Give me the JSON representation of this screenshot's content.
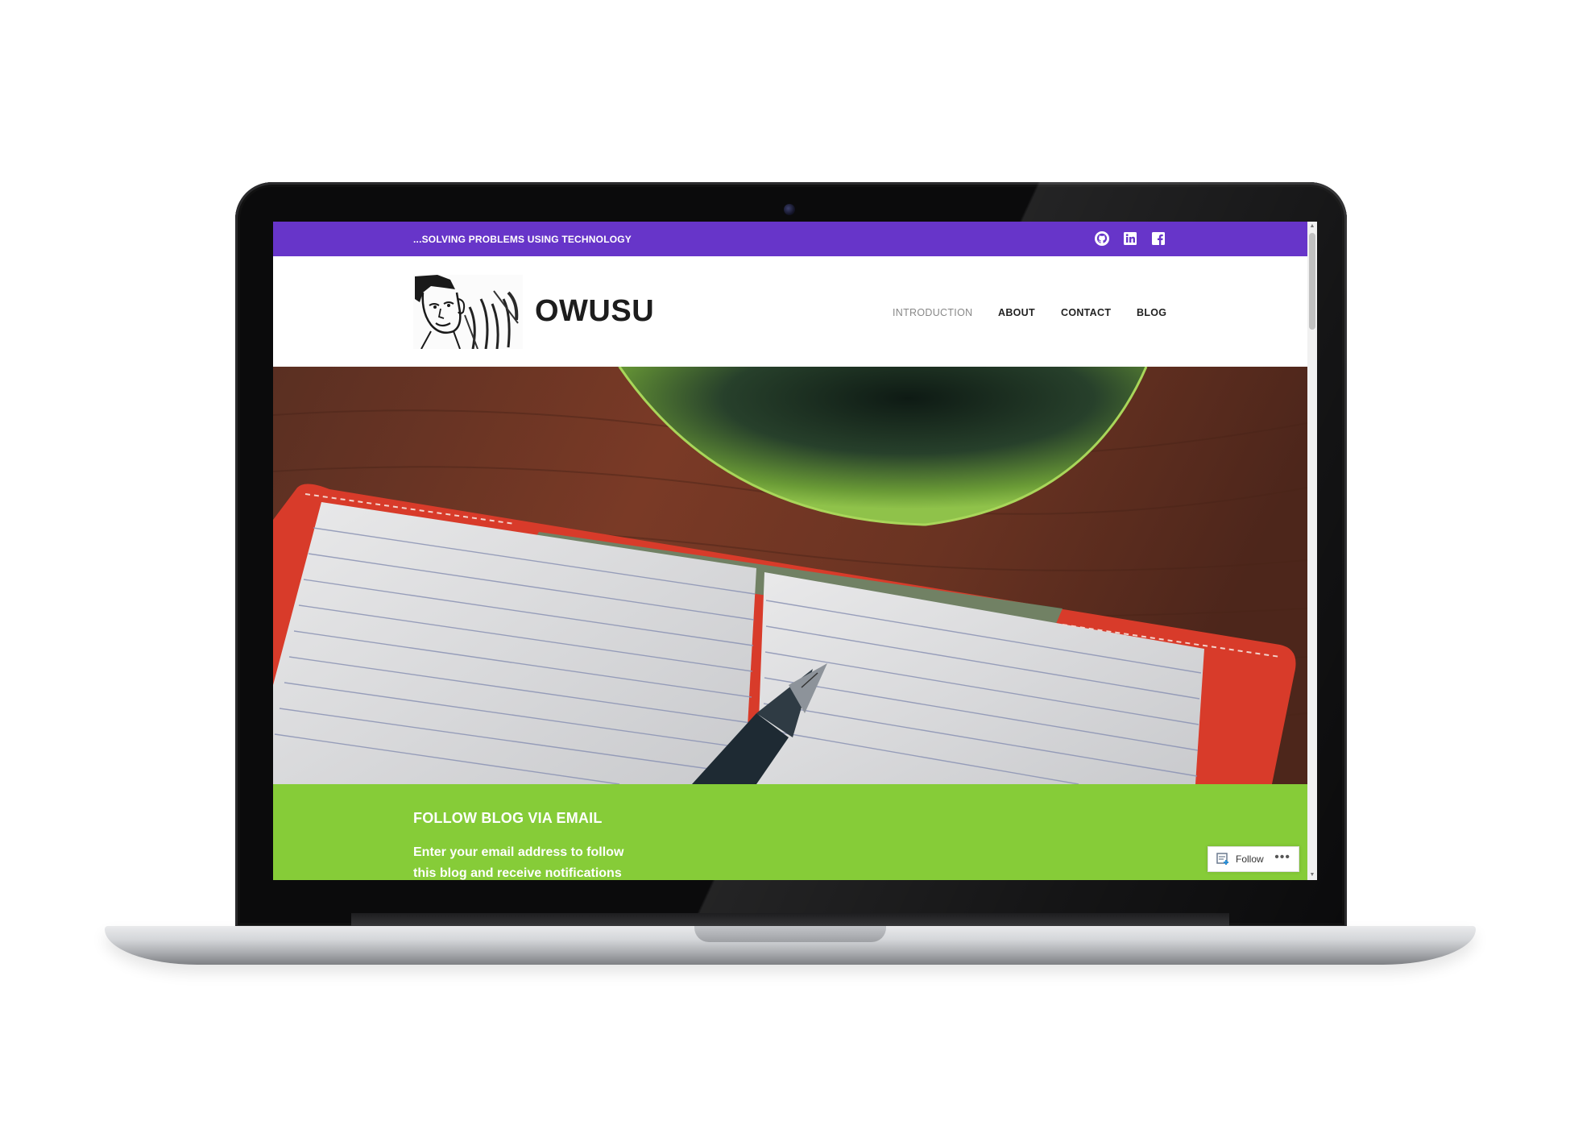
{
  "site": {
    "tagline": "...SOLVING PROBLEMS USING TECHNOLOGY",
    "title": "OWUSU"
  },
  "social_icons": [
    "github-icon",
    "linkedin-icon",
    "facebook-icon"
  ],
  "nav": {
    "items": [
      {
        "label": "INTRODUCTION",
        "active": true
      },
      {
        "label": "ABOUT",
        "active": false
      },
      {
        "label": "CONTACT",
        "active": false
      },
      {
        "label": "BLOG",
        "active": false
      }
    ]
  },
  "follow": {
    "title": "FOLLOW BLOG VIA EMAIL",
    "text_line1": "Enter your email address to follow",
    "text_line2": "this blog and receive notifications",
    "widget_label": "Follow",
    "widget_more": "•••"
  },
  "colors": {
    "topbar": "#6735c9",
    "follow_band": "#86cc38"
  }
}
